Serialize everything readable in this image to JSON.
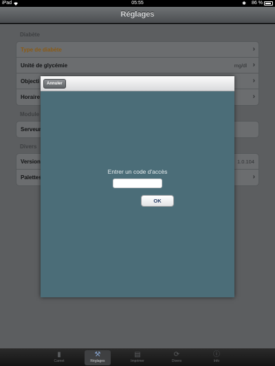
{
  "status_bar": {
    "device": "iPad",
    "time": "05:55",
    "battery": "86 %"
  },
  "nav": {
    "title": "Réglages"
  },
  "sections": {
    "diabete": {
      "title": "Diabète",
      "rows": [
        {
          "label": "Type de diabète",
          "value": ""
        },
        {
          "label": "Unité de glycémie",
          "value": "mg/dl"
        },
        {
          "label": "Objecti",
          "value": ""
        },
        {
          "label": "Horaire",
          "value": ""
        }
      ]
    },
    "modules": {
      "title": "Module",
      "rows": [
        {
          "label": "Serveur",
          "value": ""
        }
      ]
    },
    "divers": {
      "title": "Divers",
      "rows": [
        {
          "label": "Version",
          "value": "1.0.104"
        },
        {
          "label": "Palettes",
          "value": ""
        }
      ]
    }
  },
  "modal": {
    "cancel_label": "Annuler",
    "prompt": "Entrer un code d'accès",
    "input_value": "",
    "ok_label": "OK"
  },
  "tabs": [
    {
      "label": "Carnet",
      "icon": "notebook-icon"
    },
    {
      "label": "Réglages",
      "icon": "wrench-icon"
    },
    {
      "label": "Imprimer",
      "icon": "print-icon"
    },
    {
      "label": "Divers",
      "icon": "sync-icon"
    },
    {
      "label": "Info",
      "icon": "info-icon"
    }
  ],
  "colors": {
    "modal_bg": "#4b6d78",
    "accent_orange": "#8a5a14",
    "tab_active": "#8aa7d2"
  }
}
